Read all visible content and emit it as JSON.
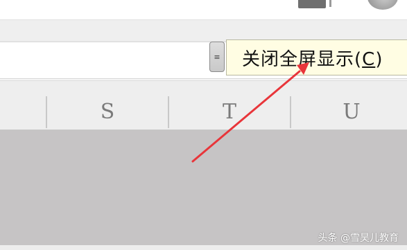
{
  "tooltip": {
    "text_before": "关闭全屏显示(",
    "hotkey": "C",
    "text_after": ")"
  },
  "handle": {
    "glyph": "≡"
  },
  "columns": [
    {
      "label": "S"
    },
    {
      "label": "T"
    },
    {
      "label": "U"
    }
  ],
  "watermark": "头条 @雪昊儿教育",
  "colors": {
    "tooltip_bg": "#fffde3",
    "arrow": "#e8353a",
    "workspace": "#c6c4c5"
  },
  "icons": {
    "handle": "menu-lines-icon",
    "arrow": "red-pointer-arrow-annotation"
  }
}
